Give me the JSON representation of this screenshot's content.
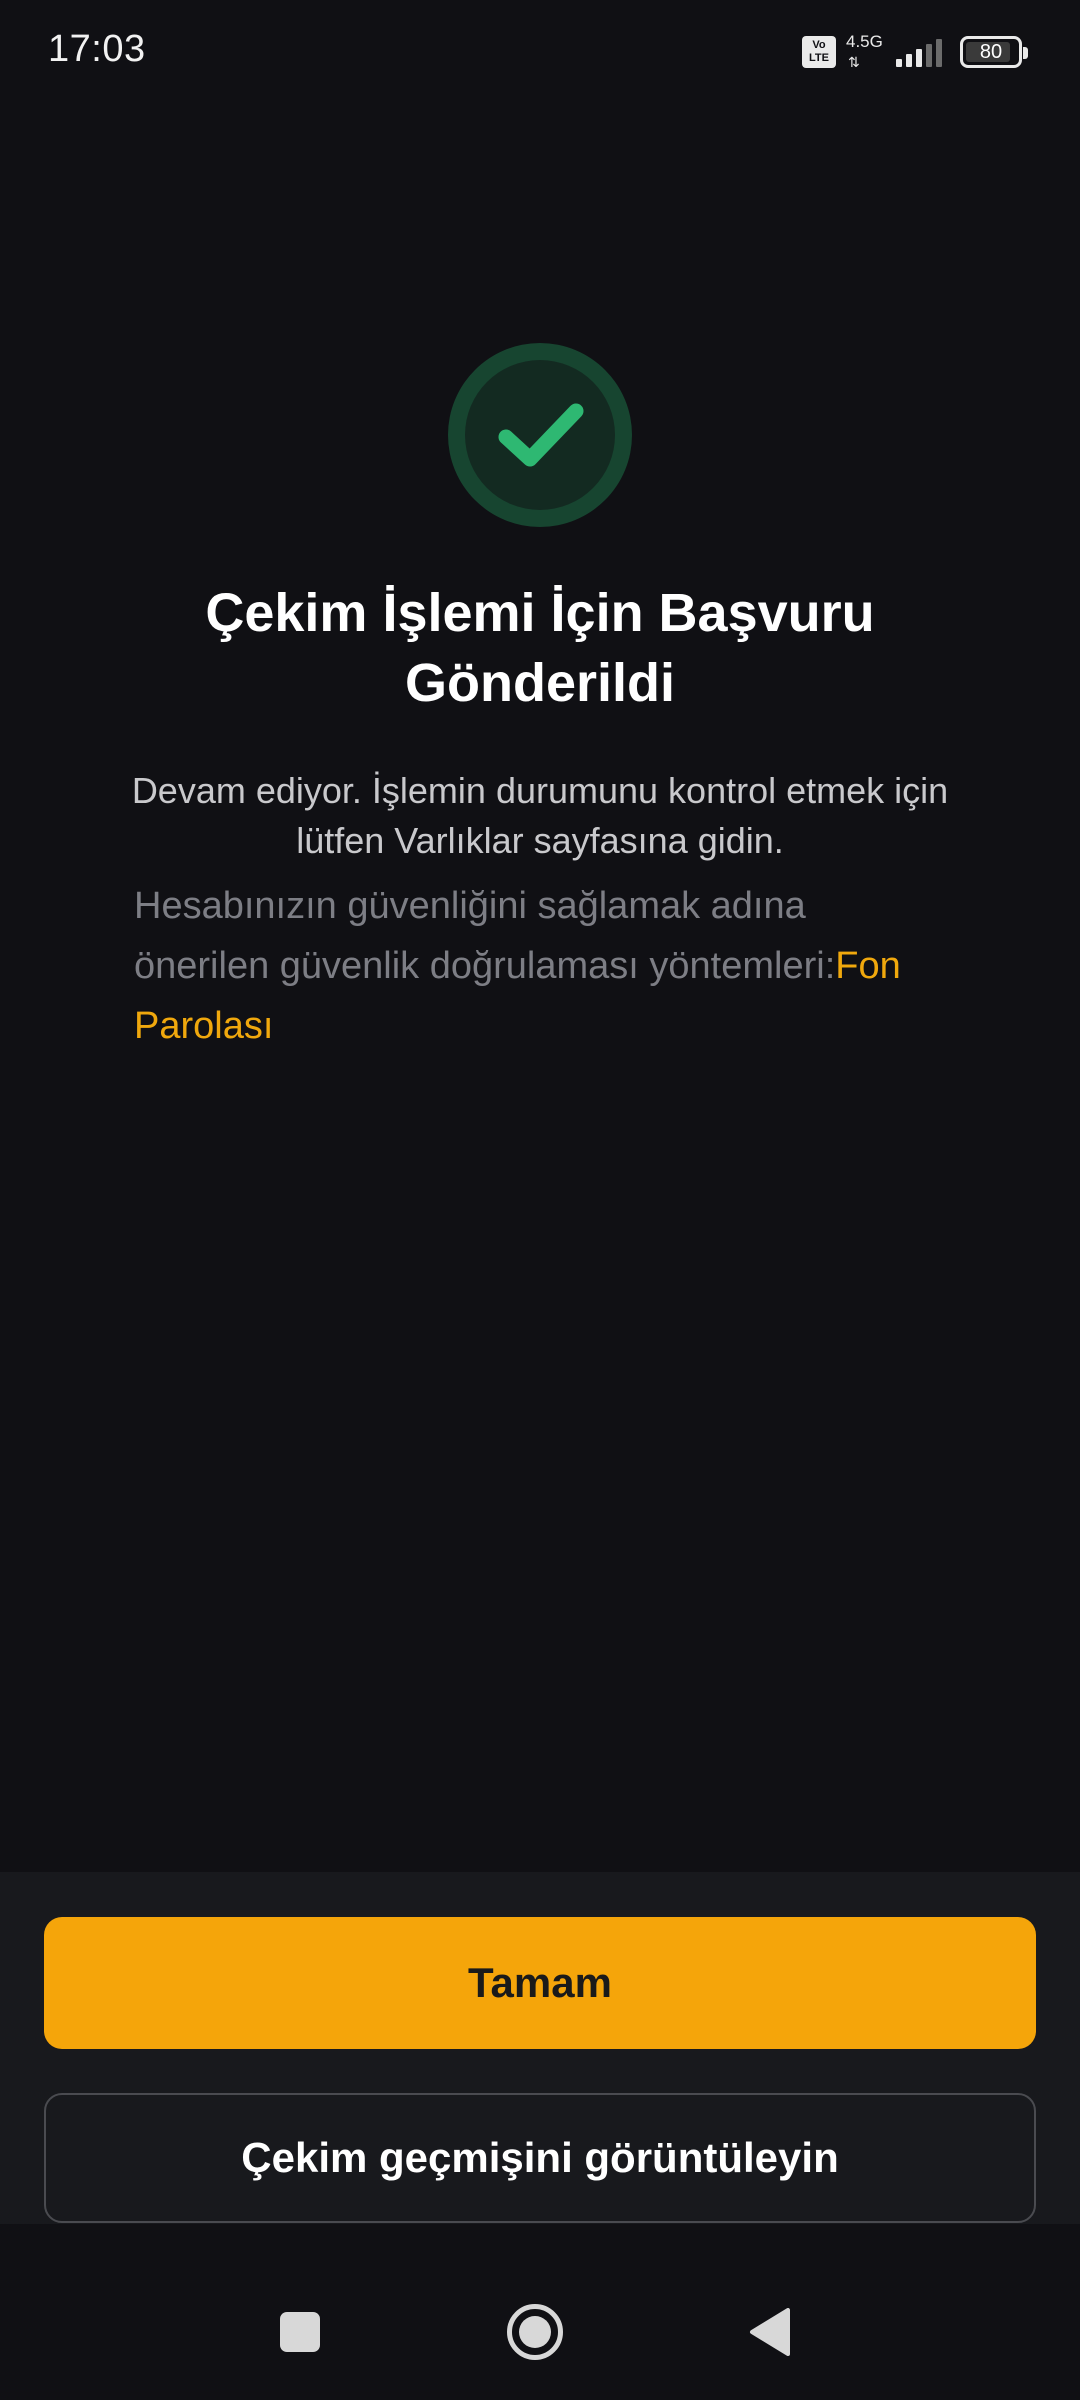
{
  "status_bar": {
    "time": "17:03",
    "volte_icon_text": "Vo LTE",
    "network_label": "4.5G",
    "battery_level": "80",
    "icons": [
      "volte-icon",
      "network-4g-icon",
      "signal-icon",
      "battery-icon"
    ]
  },
  "main": {
    "icon": "checkmark-icon",
    "title": "Çekim İşlemi İçin Başvuru Gönderildi",
    "description": "Devam ediyor. İşlemin durumunu kontrol etmek için lütfen Varlıklar sayfasına gidin.",
    "security_text": "Hesabınızın güvenliğini sağlamak adına önerilen güvenlik doğrulaması yöntemleri:",
    "security_link": "Fon Parolası"
  },
  "actions": {
    "primary_label": "Tamam",
    "secondary_label": "Çekim geçmişini görüntüleyin"
  },
  "nav": {
    "icons": [
      "recent-apps-icon",
      "home-icon",
      "back-icon"
    ]
  },
  "colors": {
    "accent": "#f5a50a",
    "success": "#2eb872",
    "link": "#f0a80d",
    "background": "#101014"
  }
}
